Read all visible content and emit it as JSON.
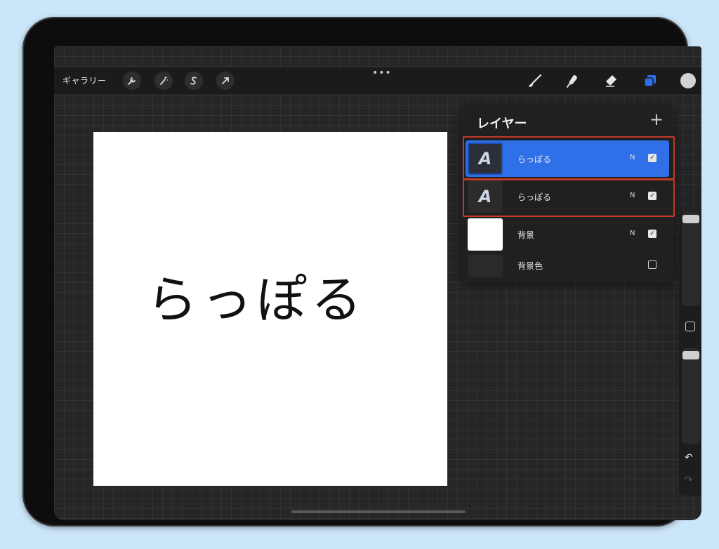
{
  "toolbar": {
    "gallery_label": "ギャラリー",
    "left_tools": [
      {
        "icon": "wrench-icon",
        "glyph": "🔧"
      },
      {
        "icon": "magic-wand-icon",
        "glyph": "✧"
      },
      {
        "icon": "selection-icon",
        "glyph": "S"
      },
      {
        "icon": "transform-arrow-icon",
        "glyph": "➚"
      }
    ],
    "more_glyph": "•••",
    "right_tools": [
      {
        "icon": "brush-icon"
      },
      {
        "icon": "smudge-icon"
      },
      {
        "icon": "eraser-icon"
      },
      {
        "icon": "layers-icon"
      }
    ],
    "color": "#d2d2d2"
  },
  "canvas": {
    "text": "らっぽる"
  },
  "layers_panel": {
    "title": "レイヤー",
    "add_glyph": "+",
    "layers": [
      {
        "name": "らっぽる",
        "blend": "N",
        "visible": true,
        "selected": true,
        "thumb": "A"
      },
      {
        "name": "らっぽる",
        "blend": "N",
        "visible": true,
        "selected": false,
        "thumb": "A"
      },
      {
        "name": "背景",
        "blend": "N",
        "visible": true,
        "selected": false,
        "thumb": ""
      },
      {
        "name": "背景色",
        "blend": "",
        "visible": false,
        "selected": false,
        "thumb": ""
      }
    ]
  },
  "sidebar": {
    "undo_glyph": "↶",
    "redo_glyph": "↷"
  },
  "colors": {
    "accent": "#2f6fe8",
    "highlight": "#c0392b"
  }
}
